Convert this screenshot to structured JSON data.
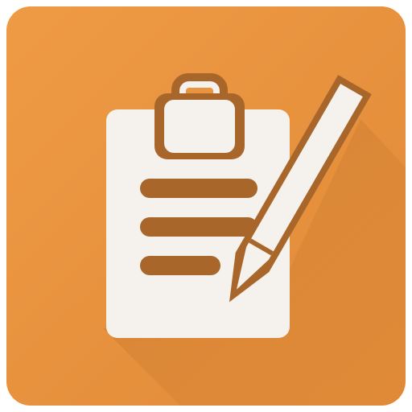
{
  "app_icon": {
    "icon": "clipboard-pencil-icon",
    "colors": {
      "background": "#EF9A45",
      "background_dark": "#E08A37",
      "foreground": "#F5F1EC",
      "lines": "#A9662A",
      "shadow": "#B76B26"
    }
  }
}
